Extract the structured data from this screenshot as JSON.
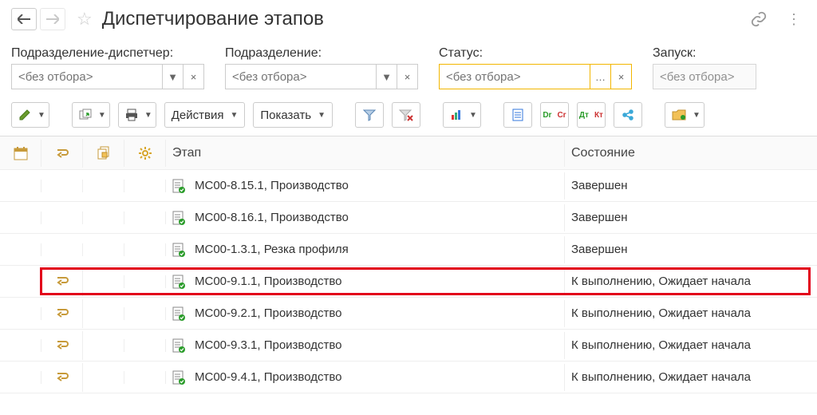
{
  "header": {
    "title": "Диспетчирование этапов"
  },
  "filters": {
    "dispatcher": {
      "label": "Подразделение-диспетчер:",
      "placeholder": "<без отбора>",
      "value": ""
    },
    "division": {
      "label": "Подразделение:",
      "placeholder": "<без отбора>",
      "value": ""
    },
    "status": {
      "label": "Статус:",
      "placeholder": "<без отбора>",
      "value": ""
    },
    "launch": {
      "label": "Запуск:",
      "placeholder": "<без отбора>",
      "value": ""
    }
  },
  "toolbar": {
    "actions_label": "Действия",
    "show_label": "Показать",
    "drcr": "Dr\nCr",
    "dtkt": "Дт\nКт"
  },
  "columns": {
    "stage": "Этап",
    "state": "Состояние"
  },
  "rows": [
    {
      "arrow": false,
      "stage": "МС00-8.15.1, Производство",
      "state": "Завершен",
      "highlight": false
    },
    {
      "arrow": false,
      "stage": "МС00-8.16.1, Производство",
      "state": "Завершен",
      "highlight": false
    },
    {
      "arrow": false,
      "stage": "МС00-1.3.1, Резка профиля",
      "state": "Завершен",
      "highlight": false
    },
    {
      "arrow": true,
      "stage": "МС00-9.1.1, Производство",
      "state": "К выполнению, Ожидает начала",
      "highlight": true
    },
    {
      "arrow": true,
      "stage": "МС00-9.2.1, Производство",
      "state": "К выполнению, Ожидает начала",
      "highlight": false
    },
    {
      "arrow": true,
      "stage": "МС00-9.3.1, Производство",
      "state": "К выполнению, Ожидает начала",
      "highlight": false
    },
    {
      "arrow": true,
      "stage": "МС00-9.4.1, Производство",
      "state": "К выполнению, Ожидает начала",
      "highlight": false
    }
  ]
}
